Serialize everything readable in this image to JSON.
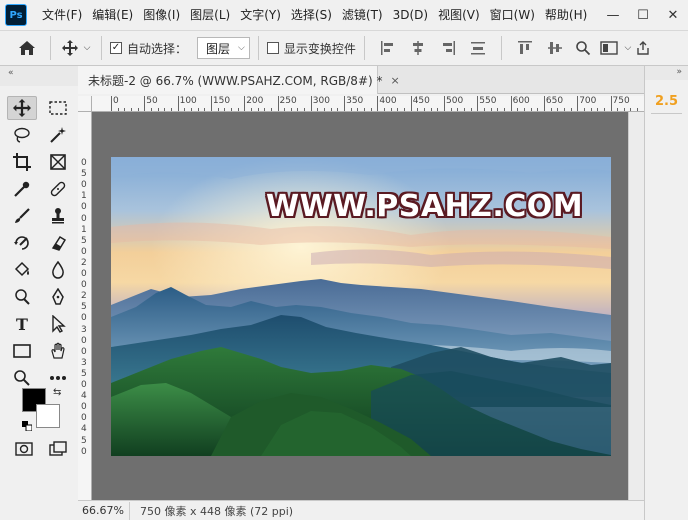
{
  "app": {
    "logo_text": "Ps",
    "menu": [
      "文件(F)",
      "编辑(E)",
      "图像(I)",
      "图层(L)",
      "文字(Y)",
      "选择(S)",
      "滤镜(T)",
      "3D(D)",
      "视图(V)",
      "窗口(W)",
      "帮助(H)"
    ],
    "window_controls": {
      "minimize": "—",
      "maximize": "☐",
      "close": "✕"
    }
  },
  "options_bar": {
    "home_icon": "home-icon",
    "move_tool_icon": "move-icon",
    "auto_select_label": "自动选择：",
    "auto_select_checked": true,
    "layer_dropdown_value": "图层",
    "show_transform_label": "显示变换控件",
    "show_transform_checked": false
  },
  "document": {
    "tab_title": "未标题-2 @ 66.7% (WWW.PSAHZ.COM, RGB/8#) *",
    "close_icon": "×",
    "watermark_text": "WWW.PSAHZ.COM"
  },
  "rulers": {
    "top_labels": [
      "0",
      "50",
      "100",
      "150",
      "200",
      "250",
      "300",
      "350",
      "400",
      "450",
      "500",
      "550",
      "600",
      "650",
      "700",
      "750"
    ],
    "left_labels": [
      "0",
      "5",
      "0",
      "1",
      "0",
      "0",
      "1",
      "5",
      "0",
      "2",
      "0",
      "0",
      "2",
      "5",
      "0",
      "3",
      "0",
      "0",
      "3",
      "5",
      "0",
      "4",
      "0",
      "0",
      "4",
      "5",
      "0"
    ]
  },
  "status": {
    "zoom": "66.67%",
    "doc_info": "750 像素 x 448 像素 (72 ppi)"
  },
  "right_panel": {
    "collapse_label": "»",
    "value": "2.5"
  },
  "toolbar": {
    "collapse_label": "«"
  },
  "colors": {
    "foreground": "#000000",
    "background": "#ffffff",
    "accent": "#f0a020"
  }
}
